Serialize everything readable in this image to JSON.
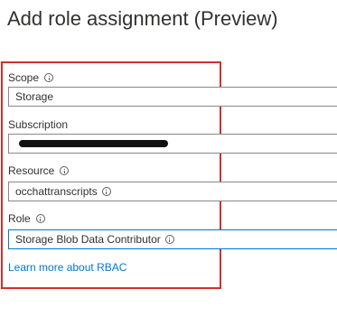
{
  "page": {
    "title": "Add role assignment (Preview)"
  },
  "form": {
    "scope": {
      "label": "Scope",
      "value": "Storage"
    },
    "subscription": {
      "label": "Subscription",
      "value": ""
    },
    "resource": {
      "label": "Resource",
      "value": "occhattranscripts"
    },
    "role": {
      "label": "Role",
      "value": "Storage Blob Data Contributor"
    },
    "learn_more_link": "Learn more about RBAC"
  },
  "colors": {
    "highlight_border": "#d32f2f",
    "link": "#0078d4",
    "focused_border": "#0078d4"
  }
}
